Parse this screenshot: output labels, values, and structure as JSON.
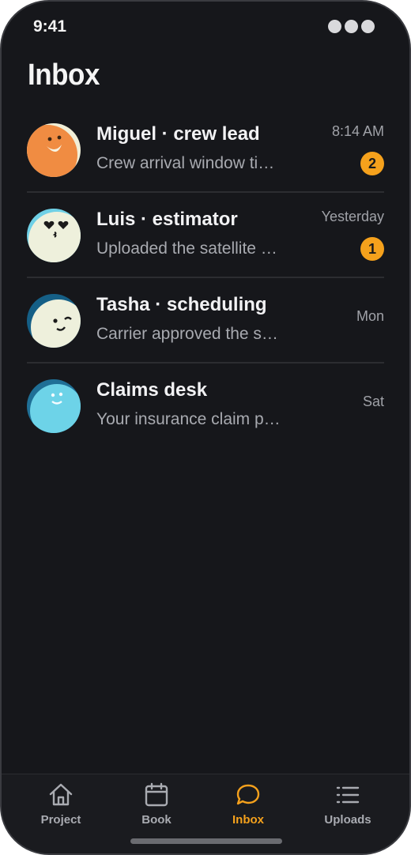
{
  "status": {
    "time": "9:41"
  },
  "page": {
    "title": "Inbox"
  },
  "threads": [
    {
      "name": "Miguel · crew lead",
      "preview": "Crew arrival window ti…",
      "time": "8:14 AM",
      "unread": "2",
      "avatar": "smiling-face-avatar"
    },
    {
      "name": "Luis · estimator",
      "preview": "Uploaded the satellite …",
      "time": "Yesterday",
      "unread": "1",
      "avatar": "heart-eyes-face-avatar"
    },
    {
      "name": "Tasha · scheduling",
      "preview": "Carrier approved the s…",
      "time": "Mon",
      "unread": "",
      "avatar": "winking-face-avatar"
    },
    {
      "name": "Claims desk",
      "preview": "Your insurance claim p…",
      "time": "Sat",
      "unread": "",
      "avatar": "happy-face-avatar"
    }
  ],
  "tabs": [
    {
      "label": "Project",
      "icon": "home-icon",
      "active": false
    },
    {
      "label": "Book",
      "icon": "calendar-icon",
      "active": false
    },
    {
      "label": "Inbox",
      "icon": "chat-bubble-icon",
      "active": true
    },
    {
      "label": "Uploads",
      "icon": "list-icon",
      "active": false
    }
  ],
  "colors": {
    "background": "#16171b",
    "accent": "#f5a11c",
    "text": "#f2f2f4",
    "muted": "#a8aab0"
  }
}
